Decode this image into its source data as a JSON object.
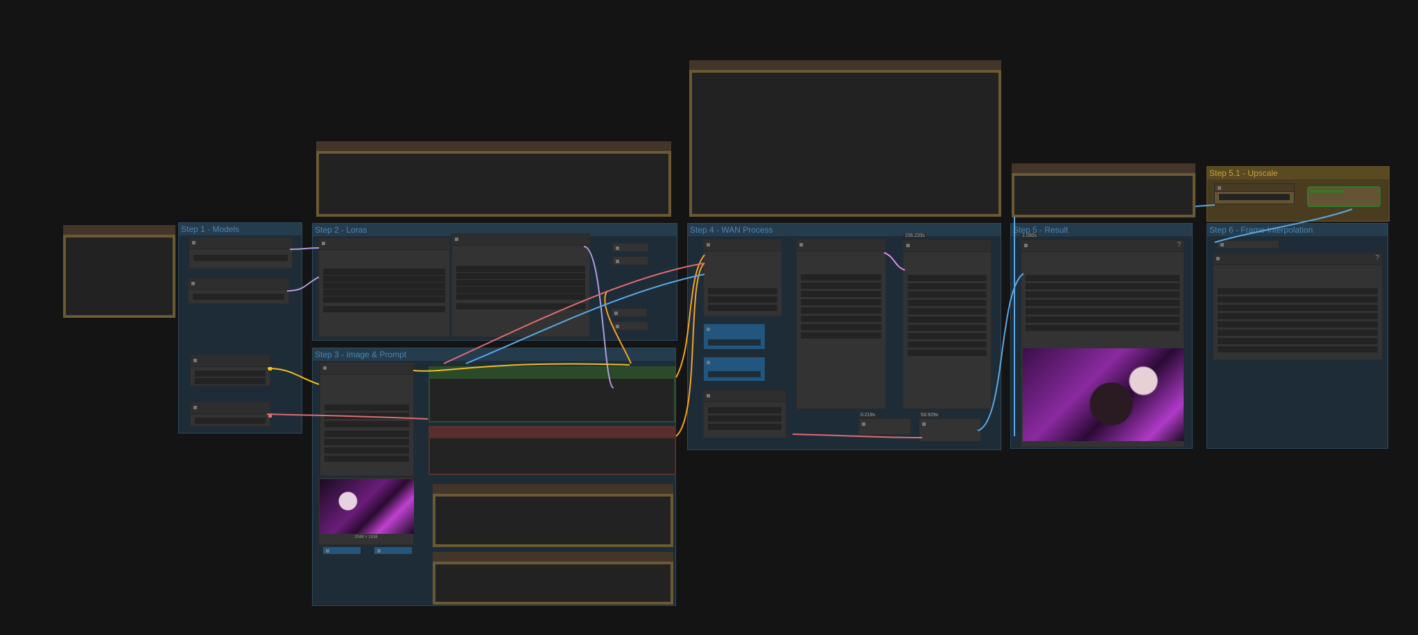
{
  "groups": {
    "step1": "Step 1 - Models",
    "step2": "Step 2 - Loras",
    "step3": "Step 3 - Image & Prompt",
    "step4": "Step 4 - WAN Process",
    "step5": "Step 5 - Result",
    "step51": "Step 5.1 - Upscale",
    "step6": "Step 6 - Frame Interpolation"
  },
  "timings": {
    "sampler_high": "156.233s",
    "decode": "0.219s",
    "sampler_low": "53.929s",
    "result": "2.090s"
  },
  "image_size": "2048 × 1536",
  "help_icon": "?",
  "colors": {
    "group": "#1e2c37",
    "group_title": "#4c86b3",
    "note_border": "#6b5a33",
    "upscale_group": "#4a3d1f"
  }
}
